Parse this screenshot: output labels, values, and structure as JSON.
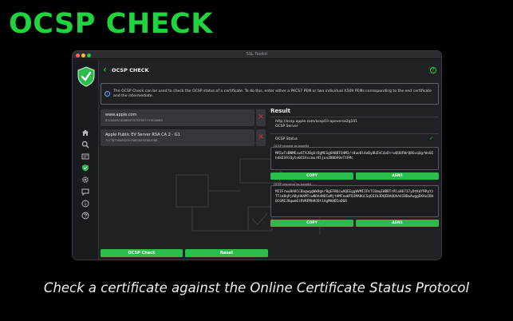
{
  "promo": {
    "title": "OCSP CHECK",
    "caption": "Check a certificate against the Online Certificate Status Protocol"
  },
  "window": {
    "title": "SSL Toolkit"
  },
  "header": {
    "title": "OCSP CHECK"
  },
  "info": {
    "text": "The OCSP Check can be used to check the OCSP status of a certificate. To do this, enter either a PKCS7 PEM or two individual X509 PEMs corresponding to the end certificate and the intermediate."
  },
  "certificates": [
    {
      "name": "www.apple.com",
      "hash": "B1C6AEAC4D8BAE7E7DF5E7797E08963"
    },
    {
      "name": "Apple Public EV Server RSA CA 2 - G1",
      "hash": "71778730083239758E0EF5E861068"
    }
  ],
  "result": {
    "title": "Result",
    "url": "http://ocsp.apple.com/ocsp03-apevsrsa2g101",
    "server_label": "OCSP Server",
    "status_label": "OCSP Status",
    "request_label": "OCSP request as base64",
    "request_value": "MFEwTzBNMEswSTAJBgUrDgMCGgUABBTO4M3/+8ue8l4eBy8UZnCdvD++wQUUFWrQ8GvqUgrWs0Ih4kES9iOyto0CEAscmurKljunZ8BOF0eTtFMc",
    "response_label": "OCSP response as base64",
    "response_value": "MIIFrwoBAKCCBagwggWkBgkrBgEFBQcwAQEEggWVMIIFkTCBmqIWBBTrRlo86737yDtKdY9PpYzTTsd8qPjAByHAAMTcwNDA4NDIwMjtHMFowWTBJMA0GCSqGSIb3DQEBAQUAA4IBDwAwggEKAoIBAQC6MIJKqwe6lRVRFMhMJDt1AgMAHD2aDGR"
  },
  "buttons": {
    "copy": "COPY",
    "asn1": "ASN1",
    "ocsp_check": "OCSP Check",
    "reset": "Reset"
  },
  "icons": {
    "logo": "shield-check-icon",
    "sidebar": [
      "home-icon",
      "search-icon",
      "certificate-icon",
      "shield-icon",
      "gear-icon",
      "chat-icon",
      "info-icon",
      "help-icon"
    ]
  },
  "colors": {
    "accent": "#2bbd4b",
    "promo_green": "#1fd43e",
    "remove_red": "#e0332f"
  }
}
